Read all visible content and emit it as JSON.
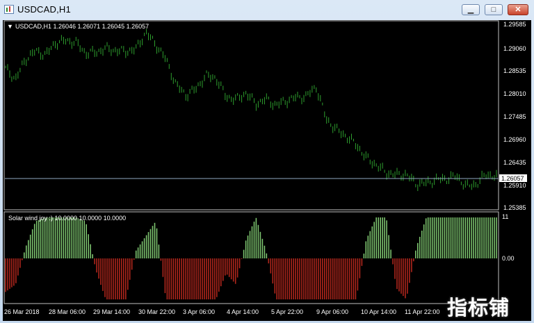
{
  "window": {
    "title": "USDCAD,H1",
    "minimize_glyph": "▁",
    "maximize_glyph": "□",
    "close_glyph": "✕"
  },
  "main_panel": {
    "header": "USDCAD,H1  1.26046 1.26071 1.26045 1.26057",
    "menu_glyph": "▼",
    "current_price": "1.26057",
    "price_labels": [
      "1.29585",
      "1.29060",
      "1.28535",
      "1.28010",
      "1.27485",
      "1.26960",
      "1.26435",
      "1.25910",
      "1.25385"
    ]
  },
  "indicator_panel": {
    "header": "Solar wind joy :) 10.0000 10.0000 10.0000",
    "scale_labels": [
      "11",
      "0.00"
    ]
  },
  "time_axis": {
    "labels": [
      "26 Mar 2018",
      "28 Mar 06:00",
      "29 Mar 14:00",
      "30 Mar 22:00",
      "3 Apr 06:00",
      "4 Apr 14:00",
      "5 Apr 22:00",
      "9 Apr 06:00",
      "10 Apr 14:00",
      "11 Apr 22:00"
    ]
  },
  "colors": {
    "background": "#000000",
    "grid_border": "#c0c0c0",
    "bars_up": "#2e9e2e",
    "histogram_positive": "#7cc36e",
    "histogram_negative": "#b0261c",
    "price_line": "#8fa9bf"
  },
  "watermark": "指标铺",
  "chart_data": {
    "type": "bar",
    "title": "USDCAD,H1",
    "series": [
      {
        "name": "USDCAD,H1",
        "values": [
          1.2856,
          1.2832,
          1.2878,
          1.2897,
          1.2888,
          1.2916,
          1.2921,
          1.2917,
          1.2892,
          1.2894,
          1.2903,
          1.2898,
          1.2896,
          1.2901,
          1.294,
          1.2912,
          1.2878,
          1.282,
          1.2795,
          1.281,
          1.284,
          1.2835,
          1.2792,
          1.2785,
          1.28,
          1.2775,
          1.2786,
          1.2772,
          1.2782,
          1.279,
          1.2792,
          1.2815,
          1.274,
          1.2716,
          1.27,
          1.2681,
          1.265,
          1.2634,
          1.2616,
          1.2611,
          1.2612,
          1.259,
          1.2592,
          1.26,
          1.2602,
          1.2608,
          1.2584,
          1.259,
          1.2613,
          1.2606
        ]
      },
      {
        "name": "Solar wind joy :)",
        "values": [
          -9,
          -7,
          3,
          10,
          11,
          11,
          11,
          11,
          10,
          -3,
          -11,
          -11,
          -11,
          2,
          6,
          10,
          -11,
          -11,
          -11,
          -11,
          -11,
          -11,
          -4,
          -7,
          5,
          11,
          2,
          -11,
          -11,
          -11,
          -11,
          -11,
          -11,
          -11,
          -11,
          -11,
          5,
          11,
          11,
          -8,
          -11,
          3,
          11,
          11,
          11,
          11,
          11,
          11,
          11,
          11
        ]
      }
    ],
    "price_axis": {
      "ylim": [
        1.25385,
        1.29585
      ]
    },
    "indicator_axis": {
      "ylim": [
        -11,
        11
      ]
    },
    "legend": "none"
  }
}
